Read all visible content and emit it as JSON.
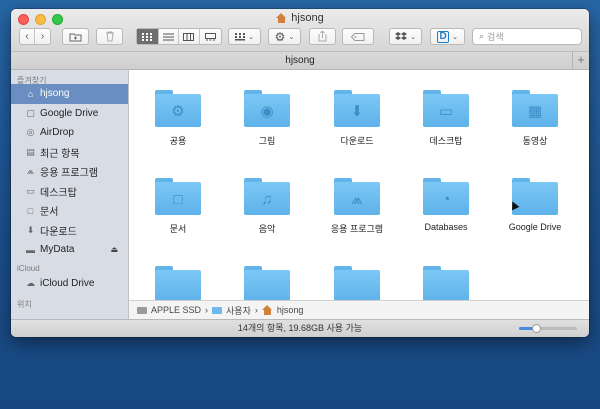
{
  "window": {
    "title": "hjsong",
    "tab_title": "hjsong"
  },
  "toolbar": {
    "search_placeholder": "검색",
    "view_modes": [
      "icon-view",
      "list-view",
      "column-view",
      "gallery-view"
    ],
    "active_view": "icon-view"
  },
  "sidebar": {
    "favorites_header": "즐겨찾기",
    "favorites": [
      {
        "label": "hjsong",
        "icon": "home-icon",
        "selected": true
      },
      {
        "label": "Google Drive",
        "icon": "google-drive-icon"
      },
      {
        "label": "AirDrop",
        "icon": "airdrop-icon"
      },
      {
        "label": "최근 항목",
        "icon": "recents-icon"
      },
      {
        "label": "응용 프로그램",
        "icon": "applications-icon"
      },
      {
        "label": "데스크탑",
        "icon": "desktop-icon"
      },
      {
        "label": "문서",
        "icon": "documents-icon"
      },
      {
        "label": "다운로드",
        "icon": "downloads-icon"
      },
      {
        "label": "MyData",
        "icon": "drive-icon",
        "eject": true
      }
    ],
    "icloud_header": "iCloud",
    "icloud": [
      {
        "label": "iCloud Drive",
        "icon": "icloud-icon"
      }
    ],
    "locations_header": "위치"
  },
  "files": [
    {
      "name": "공용",
      "icon": "public-folder-icon"
    },
    {
      "name": "그림",
      "icon": "pictures-folder-icon"
    },
    {
      "name": "다운로드",
      "icon": "downloads-folder-icon"
    },
    {
      "name": "데스크탑",
      "icon": "desktop-folder-icon"
    },
    {
      "name": "동영상",
      "icon": "movies-folder-icon"
    },
    {
      "name": "문서",
      "icon": "documents-folder-icon"
    },
    {
      "name": "음악",
      "icon": "music-folder-icon"
    },
    {
      "name": "응용 프로그램",
      "icon": "applications-folder-icon"
    },
    {
      "name": "Databases",
      "icon": "databases-folder-icon"
    },
    {
      "name": "Google Drive",
      "icon": "google-drive-folder-icon"
    },
    {
      "name": "",
      "icon": "folder-icon"
    },
    {
      "name": "",
      "icon": "folder-icon"
    },
    {
      "name": "",
      "icon": "folder-icon"
    },
    {
      "name": "",
      "icon": "folder-icon"
    }
  ],
  "pathbar": {
    "segments": [
      "APPLE SSD",
      "사용자",
      "hjsong"
    ]
  },
  "status": {
    "text": "14개의 항목, 19.68GB 사용 가능",
    "zoom_level": 0.3
  }
}
